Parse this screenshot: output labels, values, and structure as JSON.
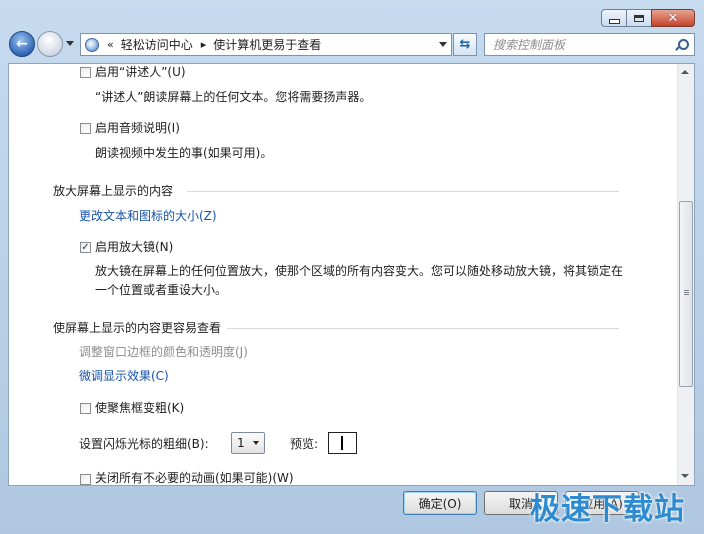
{
  "window": {
    "caption": {
      "minimize_glyph": "minimize-icon",
      "maximize_glyph": "maximize-icon",
      "close_label": "✕"
    }
  },
  "nav": {
    "back_arrow": "←",
    "forward_arrow": "→"
  },
  "address_bar": {
    "overflow": "«",
    "crumbs": [
      "轻松访问中心",
      "使计算机更易于查看"
    ],
    "separator": "▸"
  },
  "refresh_glyph": "⇆",
  "search": {
    "placeholder": "搜索控制面板"
  },
  "content": {
    "narrator": {
      "label": "启用“讲述人”(U)",
      "checked": false,
      "description": "“讲述人”朗读屏幕上的任何文本。您将需要扬声器。"
    },
    "audio_description": {
      "label": "启用音频说明(I)",
      "checked": false,
      "description": "朗读视频中发生的事(如果可用)。"
    },
    "magnify_section": {
      "title": "放大屏幕上显示的内容",
      "link_text_size": "更改文本和图标的大小(Z)",
      "magnifier_label": "启用放大镜(N)",
      "magnifier_checked": true,
      "magnifier_description": "放大镜在屏幕上的任何位置放大，使那个区域的所有内容变大。您可以随处移动放大镜，将其锁定在一个位置或者重设大小。"
    },
    "easier_section": {
      "title": "使屏幕上显示的内容更容易查看",
      "link_window_border": "调整窗口边框的颜色和透明度(J)",
      "link_display": "微调显示效果(C)",
      "focus_label": "使聚焦框变粗(K)",
      "focus_checked": false,
      "cursor_label": "设置闪烁光标的粗细(B):",
      "cursor_value": "1",
      "preview_label": "预览:",
      "animations_label": "关闭所有不必要的动画(如果可能)(W)"
    }
  },
  "buttons": {
    "ok": "确定(O)",
    "cancel": "取消",
    "apply": "应用(A)"
  },
  "watermark": "极速下载站"
}
